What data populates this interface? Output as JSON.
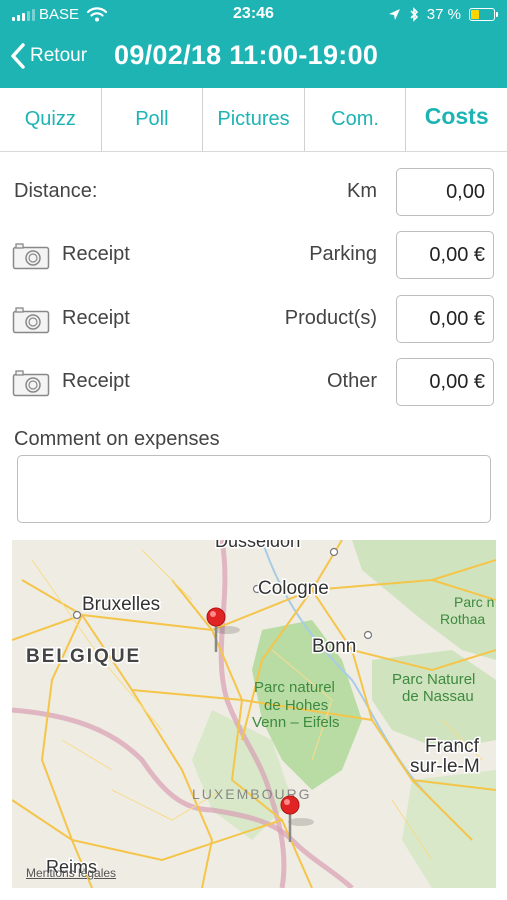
{
  "status_bar": {
    "carrier": "BASE",
    "time": "23:46",
    "battery_percent": "37 %",
    "battery_level": 0.37,
    "icons": [
      "signal-icon",
      "wifi-icon",
      "location-arrow-icon",
      "bluetooth-icon",
      "battery-icon"
    ]
  },
  "nav": {
    "back_label": "Retour",
    "title": "09/02/18 11:00-19:00"
  },
  "tabs": [
    {
      "label": "Quizz",
      "active": false
    },
    {
      "label": "Poll",
      "active": false
    },
    {
      "label": "Pictures",
      "active": false
    },
    {
      "label": "Com.",
      "active": false
    },
    {
      "label": "Costs",
      "active": true
    }
  ],
  "costs": {
    "distance": {
      "label": "Distance:",
      "unit_label": "Km",
      "value": "0,00"
    },
    "items": [
      {
        "receipt_label": "Receipt",
        "label": "Parking",
        "value": "0,00 €"
      },
      {
        "receipt_label": "Receipt",
        "label": "Product(s)",
        "value": "0,00 €"
      },
      {
        "receipt_label": "Receipt",
        "label": "Other",
        "value": "0,00 €"
      }
    ],
    "comment_label": "Comment on expenses",
    "comment_value": ""
  },
  "map": {
    "labels": {
      "dusseldorf": "Dusseldorf",
      "cologne": "Cologne",
      "bruxelles": "Bruxelles",
      "belgique": "BELGIQUE",
      "bonn": "Bonn",
      "parc_nr1": "Parc n",
      "parc_nr2": "Rothaa",
      "parc_hohes1": "Parc naturel",
      "parc_hohes2": "de Hohes",
      "parc_hohes3": "Venn – Eifels",
      "parc_nassau1": "Parc Naturel",
      "parc_nassau2": "de Nassau",
      "frankfurt1": "Francf",
      "frankfurt2": "sur-le-M",
      "luxembourg": "LUXEMBOURG",
      "reims": "Reims"
    },
    "legal": "Mentions légales",
    "pin_color": "#e02424",
    "park_color": "#b9dca5",
    "road_color": "#f5c54a",
    "border_color": "#d9a0b4"
  },
  "colors": {
    "accent": "#1eb4b4"
  }
}
